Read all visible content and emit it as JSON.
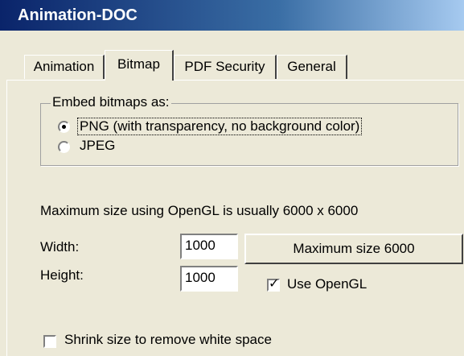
{
  "window": {
    "title": "Animation-DOC"
  },
  "tabs": [
    {
      "label": "Animation",
      "active": false
    },
    {
      "label": "Bitmap",
      "active": true
    },
    {
      "label": "PDF Security",
      "active": false
    },
    {
      "label": "General",
      "active": false
    }
  ],
  "embed": {
    "legend": "Embed bitmaps as:",
    "options": [
      {
        "label": "PNG (with transparency, no background color)",
        "selected": true
      },
      {
        "label": "JPEG",
        "selected": false
      }
    ]
  },
  "info_text": "Maximum size using OpenGL is usually 6000 x 6000",
  "size": {
    "width_label": "Width:",
    "width_value": "1000",
    "height_label": "Height:",
    "height_value": "1000",
    "max_button_label": "Maximum size 6000"
  },
  "use_opengl": {
    "label": "Use OpenGL",
    "checked": true
  },
  "shrink": {
    "label": "Shrink size to remove white space",
    "checked": false
  }
}
